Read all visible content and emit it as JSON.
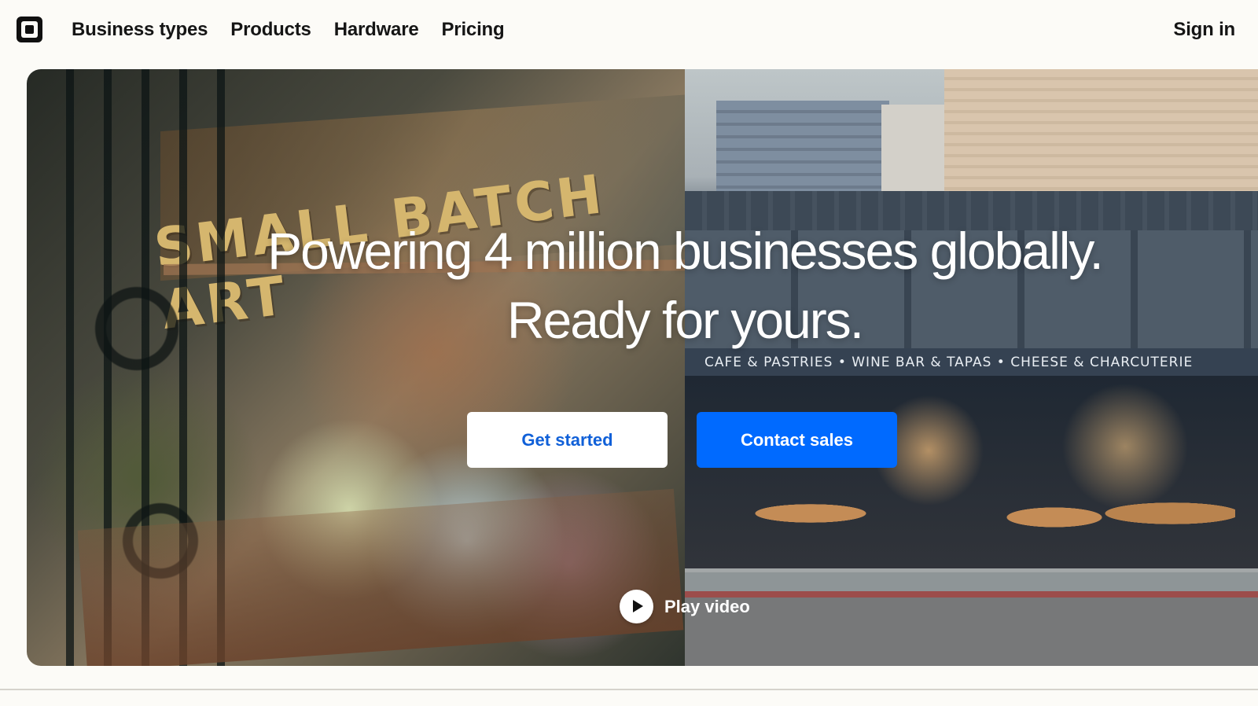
{
  "header": {
    "logo_label": "Square",
    "nav": [
      "Business types",
      "Products",
      "Hardware",
      "Pricing"
    ],
    "sign_in": "Sign in"
  },
  "hero": {
    "headline_line1": "Powering 4 million businesses globally.",
    "headline_line2": "Ready for yours.",
    "left_sign_text": "SMALL BATCH ART",
    "awning_text": "CAFE & PASTRIES • WINE BAR & TAPAS • CHEESE & CHARCUTERIE",
    "primary_cta": "Get started",
    "secondary_cta": "Contact sales",
    "play_video": "Play video"
  },
  "colors": {
    "brand_blue": "#006aff",
    "text": "#151515",
    "background": "#fcfbf7"
  },
  "icons": {
    "logo": "square-logo-icon",
    "play": "play-icon"
  }
}
